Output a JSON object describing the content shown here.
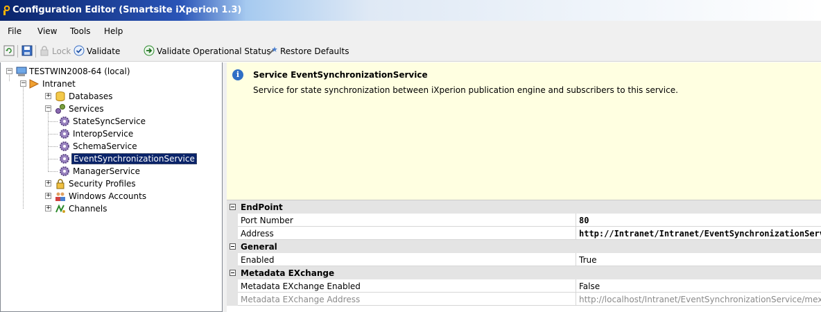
{
  "window": {
    "title": "Configuration Editor (Smartsite iXperion 1.3)"
  },
  "menu": [
    "File",
    "View",
    "Tools",
    "Help"
  ],
  "toolbar": {
    "lock": "Lock",
    "validate": "Validate",
    "validate_operational": "Validate Operational Status",
    "restore": "Restore Defaults"
  },
  "tree": {
    "root": "TESTWIN2008-64 (local)",
    "intranet": "Intranet",
    "databases": "Databases",
    "services": "Services",
    "service_items": [
      "StateSyncService",
      "InteropService",
      "SchemaService",
      "EventSynchronizationService",
      "ManagerService"
    ],
    "security_profiles": "Security Profiles",
    "windows_accounts": "Windows Accounts",
    "channels": "Channels"
  },
  "info": {
    "title": "Service EventSynchronizationService",
    "description": "Service for state synchronization between iXperion publication engine and subscribers to this service."
  },
  "grid": {
    "endpoint": {
      "category": "EndPoint",
      "port_label": "Port Number",
      "port_value": "80",
      "address_label": "Address",
      "address_value": "http://Intranet/Intranet/EventSynchronizationServic"
    },
    "general": {
      "category": "General",
      "enabled_label": "Enabled",
      "enabled_value": "True"
    },
    "metadata": {
      "category": "Metadata EXchange",
      "enabled_label": "Metadata EXchange Enabled",
      "enabled_value": "False",
      "address_label": "Metadata EXchange Address",
      "address_value": "http://localhost/Intranet/EventSynchronizationService/mex"
    }
  }
}
